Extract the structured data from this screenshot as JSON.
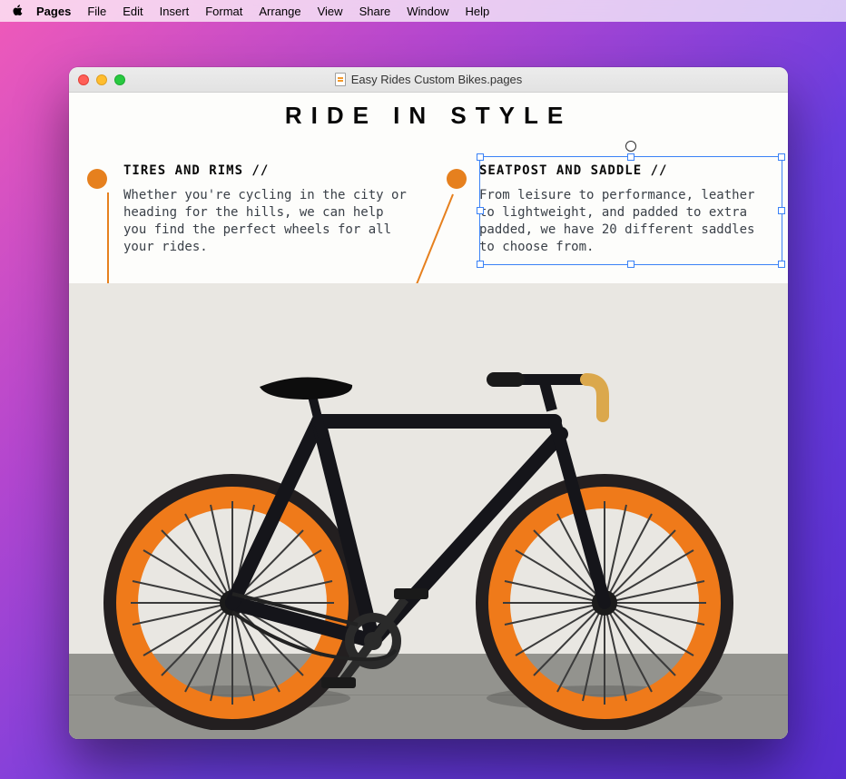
{
  "menubar": {
    "app": "Pages",
    "items": [
      "File",
      "Edit",
      "Insert",
      "Format",
      "Arrange",
      "View",
      "Share",
      "Window",
      "Help"
    ]
  },
  "window": {
    "title": "Easy Rides Custom Bikes.pages"
  },
  "document": {
    "title": "RIDE IN STYLE",
    "callouts": [
      {
        "heading": "TIRES AND RIMS //",
        "body": "Whether you're cycling in the city or heading for the hills, we can help you find the perfect wheels for all your rides."
      },
      {
        "heading": "SEATPOST AND SADDLE //",
        "body": "From leisure to performance, leather to lightweight, and padded to extra padded, we have 20 different saddles to choose from."
      }
    ]
  },
  "colors": {
    "accent": "#e6801e",
    "selection": "#3b82f6"
  }
}
